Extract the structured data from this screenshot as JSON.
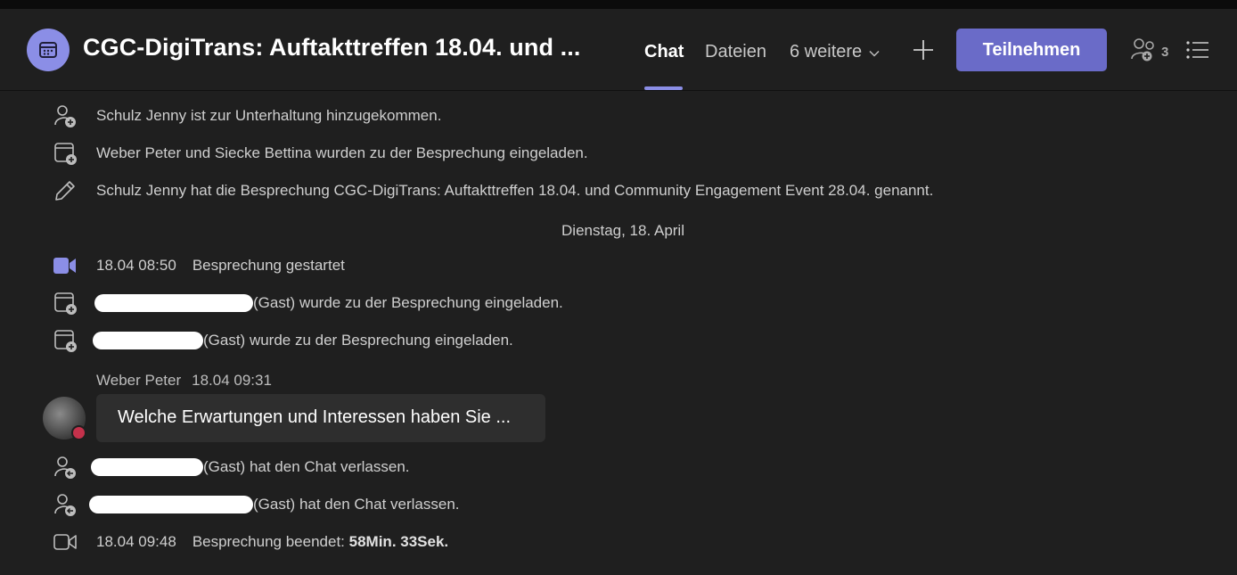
{
  "header": {
    "title": "CGC-DigiTrans: Auftakttreffen 18.04. und ...",
    "tabs": {
      "chat": "Chat",
      "files": "Dateien",
      "more": "6 weitere"
    },
    "join_label": "Teilnehmen",
    "participant_count": "3",
    "accent_color": "#8b8ee6"
  },
  "events": [
    {
      "icon": "person-add-icon",
      "text": "Schulz Jenny ist zur Unterhaltung hinzugekommen."
    },
    {
      "icon": "calendar-add-icon",
      "text": "Weber Peter und Siecke Bettina wurden zu der Besprechung eingeladen."
    },
    {
      "icon": "pencil-icon",
      "text": "Schulz Jenny hat die Besprechung CGC-DigiTrans: Auftakttreffen 18.04. und Community Engagement Event 28.04. genannt."
    }
  ],
  "date_divider": "Dienstag, 18. April",
  "meeting_started": {
    "time": "18.04 08:50",
    "text": "Besprechung gestartet"
  },
  "invites": [
    {
      "text": "(Gast) wurde zu der Besprechung eingeladen."
    },
    {
      "text": "(Gast) wurde zu der Besprechung eingeladen."
    }
  ],
  "message": {
    "sender": "Weber Peter",
    "time": "18.04 09:31",
    "text": "Welche Erwartungen und Interessen haben Sie ..."
  },
  "leaves": [
    {
      "text": "(Gast) hat den Chat verlassen."
    },
    {
      "text": "(Gast) hat den Chat verlassen."
    }
  ],
  "meeting_ended": {
    "time": "18.04 09:48",
    "text": "Besprechung beendet:",
    "duration": "58Min. 33Sek."
  }
}
